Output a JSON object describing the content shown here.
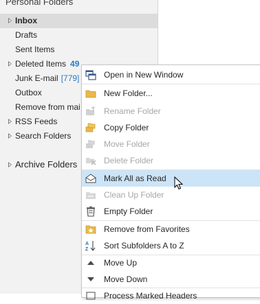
{
  "folder_pane": {
    "section_header": "Personal Folders",
    "items": [
      {
        "label": "Inbox",
        "bold": true,
        "selected": true,
        "caret": true
      },
      {
        "label": "Drafts"
      },
      {
        "label": "Sent Items"
      },
      {
        "label": "Deleted Items",
        "count": "49",
        "caret": true
      },
      {
        "label": "Junk E-mail",
        "count_bracket": "[779]"
      },
      {
        "label": "Outbox"
      },
      {
        "label": "Remove from mai"
      },
      {
        "label": "RSS Feeds",
        "caret": true
      },
      {
        "label": "Search Folders",
        "caret": true
      }
    ],
    "archive_label": "Archive Folders"
  },
  "context_menu": {
    "items": [
      {
        "label": "Open in New Window",
        "icon": "open-window-icon",
        "enabled": true
      },
      {
        "label": "New Folder...",
        "icon": "new-folder-icon",
        "enabled": true
      },
      {
        "label": "Rename Folder",
        "icon": "rename-folder-icon",
        "enabled": false
      },
      {
        "label": "Copy Folder",
        "icon": "copy-folder-icon",
        "enabled": true
      },
      {
        "label": "Move Folder",
        "icon": "move-folder-icon",
        "enabled": false
      },
      {
        "label": "Delete Folder",
        "icon": "delete-folder-icon",
        "enabled": false
      },
      {
        "label": "Mark All as Read",
        "icon": "mark-read-icon",
        "enabled": true,
        "hover": true
      },
      {
        "label": "Clean Up Folder",
        "icon": "clean-up-icon",
        "enabled": false
      },
      {
        "label": "Empty Folder",
        "icon": "empty-folder-icon",
        "enabled": true
      },
      {
        "label": "Remove from Favorites",
        "icon": "favorites-icon",
        "enabled": true
      },
      {
        "label": "Sort Subfolders A to Z",
        "icon": "sort-az-icon",
        "enabled": true
      },
      {
        "label": "Move Up",
        "icon": "arrow-up-icon",
        "enabled": true
      },
      {
        "label": "Move Down",
        "icon": "arrow-down-icon",
        "enabled": true
      },
      {
        "label": "Process Marked Headers",
        "icon": "process-headers-icon",
        "enabled": true
      }
    ]
  },
  "colors": {
    "pane_bg": "#f2f2f2",
    "selected_bg": "#dcdcdc",
    "hover_bg": "#cce4f7",
    "count_blue": "#2b79c2",
    "disabled_text": "#a6a6a6"
  }
}
